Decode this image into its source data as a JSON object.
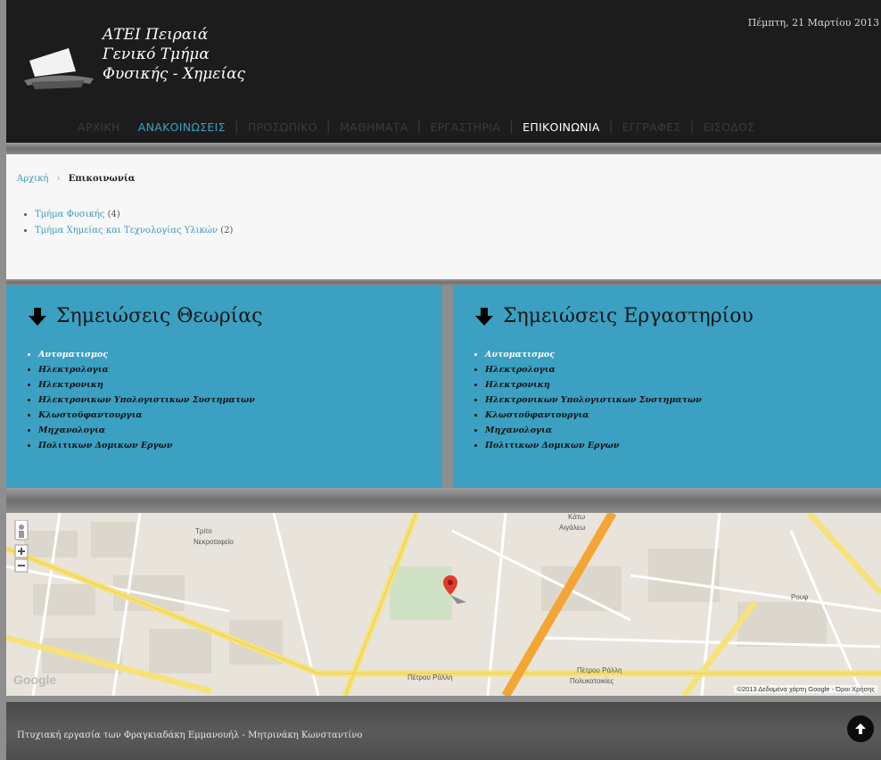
{
  "header": {
    "logo_lines": [
      "ΑΤΕΙ Πειραιά",
      "Γενικό Τμήμα",
      "Φυσικής - Χημείας"
    ],
    "date": "Πέμπτη, 21 Μαρτίου 2013"
  },
  "nav": {
    "items": [
      {
        "label": "ΑΡΧΙΚΗ"
      },
      {
        "label": "ΑΝΑΚΟΙΝΩΣΕΙΣ"
      },
      {
        "label": "ΠΡΟΣΩΠΙΚΟ"
      },
      {
        "label": "ΜΑΘΗΜΑΤΑ"
      },
      {
        "label": "ΕΡΓΑΣΤΗΡΙΑ"
      },
      {
        "label": "ΕΠΙΚΟΙΝΩΝΙΑ"
      },
      {
        "label": "ΕΓΓΡΑΦΕΣ"
      },
      {
        "label": "ΕΙΣΟΔΟΣ"
      }
    ],
    "separator": "|"
  },
  "breadcrumb": {
    "home": "Αρχική",
    "separator": "›",
    "current": "Επικοινωνία"
  },
  "contacts": [
    {
      "label": "Τμήμα Φυσικής",
      "count": "(4)"
    },
    {
      "label": "Τμήμα Χημείας και Τεχνολογίας Υλικών",
      "count": "(2)"
    }
  ],
  "theory_box": {
    "title": "Σημειώσεις Θεωρίας",
    "items": [
      "Αυτοματισμος",
      "Ηλεκτρολογια",
      "Ηλεκτρονικη",
      "Ηλεκτρονικων Υπολογιστικων Συστηματων",
      "Κλωστοϋφαντουργια",
      "Μηχανολογια",
      "Πολιτικων Δομικων Εργων"
    ]
  },
  "lab_box": {
    "title": "Σημειώσεις Εργαστηρίου",
    "items": [
      "Αυτοματισμος",
      "Ηλεκτρολογια",
      "Ηλεκτρονικη",
      "Ηλεκτρονικων Υπολογιστικων Συστηματων",
      "Κλωστοϋφαντουργια",
      "Μηχανολογια",
      "Πολιτικων Δομικων Εργων"
    ]
  },
  "map": {
    "labels": {
      "trito": "Τρίτο",
      "nekrotafeio": "Νεκροταφείο",
      "kato": "Κάτω",
      "aigaleo": "Αιγάλεω",
      "petrou_ralli_1": "Πέτρου Ράλλη",
      "petrou_ralli_2": "Πέτρου Ράλλη",
      "polykatoikies": "Πολυκατοικίες",
      "rouf": "Ρουφ"
    },
    "google": "Google",
    "copyright": "©2013 Δεδομένα χάρτη Google - Όροι Χρήσης"
  },
  "footer": {
    "text": "Πτυχιακή εργασία των Φραγκιαδάκη Εμμανουήλ - Μητρινάκη Κωνσταντίνο"
  },
  "colors": {
    "accent": "#39a2c3",
    "box_blue": "#3ba0c1",
    "header_bg": "#1c1c1c"
  }
}
